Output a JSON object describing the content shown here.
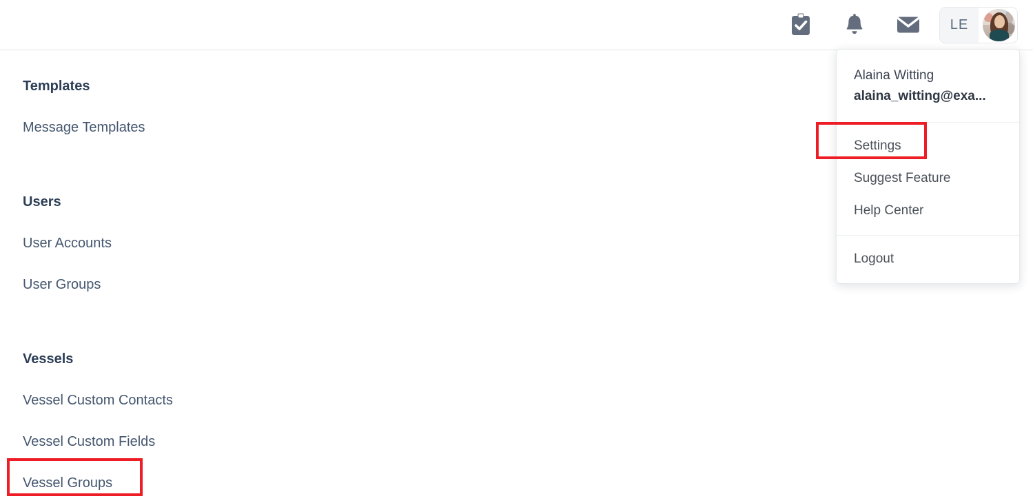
{
  "header": {
    "icons": [
      {
        "name": "tasks-icon",
        "label": "Tasks"
      },
      {
        "name": "notifications-bell-icon",
        "label": "Notifications"
      },
      {
        "name": "messages-envelope-icon",
        "label": "Messages"
      }
    ],
    "profile_button": {
      "initials": "LE",
      "avatar_alt": "Alaina Witting avatar"
    }
  },
  "settings_nav": {
    "groups": [
      {
        "heading": "Templates",
        "items": [
          {
            "label": "Message Templates",
            "highlighted": false
          }
        ]
      },
      {
        "heading": "Users",
        "items": [
          {
            "label": "User Accounts",
            "highlighted": false
          },
          {
            "label": "User Groups",
            "highlighted": false
          }
        ]
      },
      {
        "heading": "Vessels",
        "items": [
          {
            "label": "Vessel Custom Contacts",
            "highlighted": false
          },
          {
            "label": "Vessel Custom Fields",
            "highlighted": false
          },
          {
            "label": "Vessel Groups",
            "highlighted": true
          }
        ]
      }
    ]
  },
  "profile_dropdown": {
    "user_name": "Alaina Witting",
    "user_email": "alaina_witting@exa...",
    "menu_items": [
      {
        "label": "Settings",
        "highlighted": true
      },
      {
        "label": "Suggest Feature",
        "highlighted": false
      },
      {
        "label": "Help Center",
        "highlighted": false
      }
    ],
    "logout_label": "Logout"
  },
  "colors": {
    "highlight_box": "#ee1c25",
    "heading_text": "#2c3e56",
    "link_text": "#44566e",
    "icon_gray": "#646d7d"
  }
}
